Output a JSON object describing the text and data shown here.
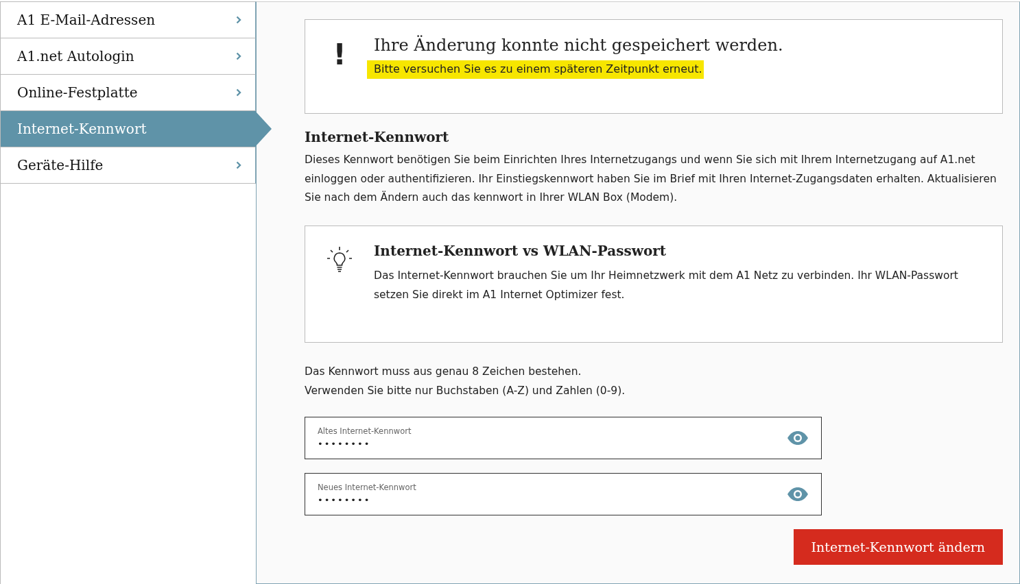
{
  "sidebar": {
    "items": [
      {
        "label": "A1 E-Mail-Adressen",
        "selected": false
      },
      {
        "label": "A1.net Autologin",
        "selected": false
      },
      {
        "label": "Online-Festplatte",
        "selected": false
      },
      {
        "label": "Internet-Kennwort",
        "selected": true
      },
      {
        "label": "Geräte-Hilfe",
        "selected": false
      }
    ]
  },
  "error_box": {
    "icon": "!",
    "title": "Ihre Änderung konnte nicht gespeichert werden.",
    "message": "Bitte versuchen Sie es zu einem späteren Zeitpunkt erneut.",
    "highlighted": true
  },
  "section": {
    "heading": "Internet-Kennwort",
    "description": "Dieses Kennwort benötigen Sie beim Einrichten Ihres Internetzugangs und wenn Sie sich mit Ihrem Internetzugang auf A1.net einloggen oder authentifizieren. Ihr Einstiegskennwort haben Sie im Brief mit Ihren Internet-Zugangsdaten erhalten. Aktualisieren Sie nach dem Ändern auch das kennwort in Ihrer WLAN Box (Modem)."
  },
  "tip_box": {
    "title": "Internet-Kennwort vs WLAN-Passwort",
    "text": "Das Internet-Kennwort brauchen Sie um Ihr Heimnetzwerk mit dem A1 Netz zu verbinden. Ihr WLAN-Passwort setzen Sie direkt im A1 Internet Optimizer fest."
  },
  "rules": [
    "Das Kennwort muss aus genau 8 Zeichen bestehen.",
    "Verwenden Sie bitte nur Buchstaben (A-Z) und Zahlen (0-9)."
  ],
  "fields": [
    {
      "label": "Altes Internet-Kennwort",
      "value": "••••••••"
    },
    {
      "label": "Neues Internet-Kennwort",
      "value": "••••••••"
    }
  ],
  "submit_button": "Internet-Kennwort ändern"
}
